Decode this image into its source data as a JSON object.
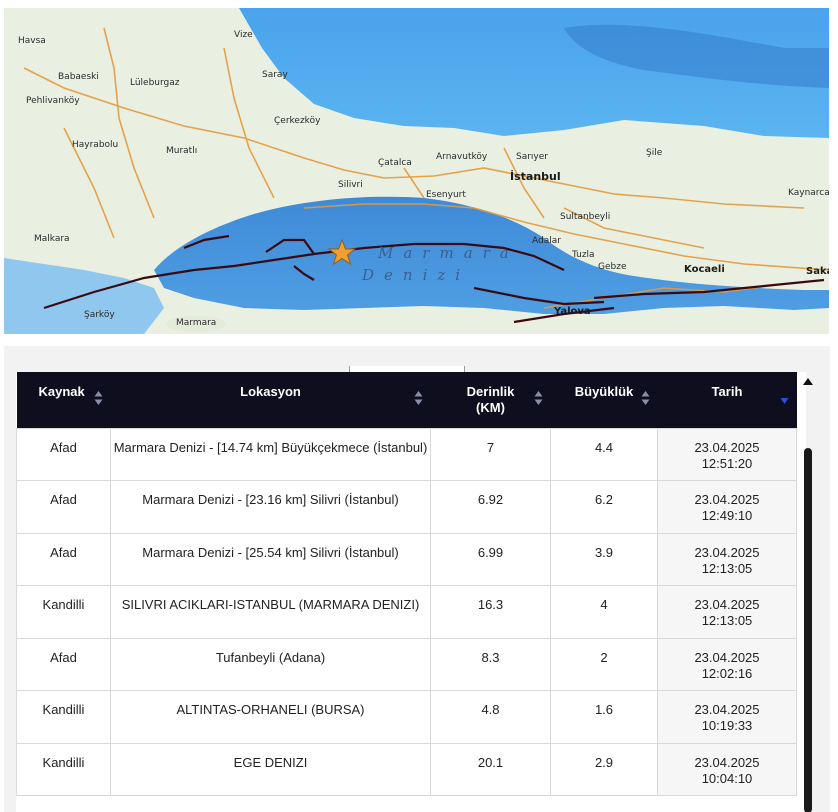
{
  "map": {
    "sea_name_line1": "Marmara",
    "sea_name_line2": "Denizi",
    "labels": {
      "havsa": "Havsa",
      "babaeski": "Babaeski",
      "pehlivankoy": "Pehlivanköy",
      "luleburgaz": "Lüleburgaz",
      "vize": "Vize",
      "saray": "Saray",
      "cerkezkoy": "Çerkezköy",
      "hayrabolu": "Hayrabolu",
      "muratli": "Muratlı",
      "catalca": "Çatalca",
      "arnavutkoy": "Arnavutköy",
      "sariyer": "Sarıyer",
      "sile": "Şile",
      "istanbul": "İstanbul",
      "silivri": "Silivri",
      "esenyurt": "Esenyurt",
      "sultanbeyli": "Sultanbeyli",
      "kaynarca": "Kaynarca",
      "malkara": "Malkara",
      "adalar": "Adalar",
      "tuzla": "Tuzla",
      "gebze": "Gebze",
      "kocaeli": "Kocaeli",
      "yalova": "Yalova",
      "sarkoy": "Şarköy",
      "marmara": "Marmara",
      "sak": "Saka"
    }
  },
  "table": {
    "headers": {
      "source": "Kaynak",
      "location": "Lokasyon",
      "depth_line1": "Derinlik",
      "depth_line2": "(KM)",
      "magnitude": "Büyüklük",
      "date": "Tarih"
    },
    "rows": [
      {
        "source": "Afad",
        "location": "Marmara Denizi - [14.74 km] Büyükçekmece (İstanbul)",
        "depth": "7",
        "magnitude": "4.4",
        "date": "23.04.2025",
        "time": "12:51:20"
      },
      {
        "source": "Afad",
        "location": "Marmara Denizi - [23.16 km] Silivri (İstanbul)",
        "depth": "6.92",
        "magnitude": "6.2",
        "date": "23.04.2025",
        "time": "12:49:10"
      },
      {
        "source": "Afad",
        "location": "Marmara Denizi - [25.54 km] Silivri (İstanbul)",
        "depth": "6.99",
        "magnitude": "3.9",
        "date": "23.04.2025",
        "time": "12:13:05"
      },
      {
        "source": "Kandilli",
        "location": "SILIVRI ACIKLARI-ISTANBUL (MARMARA DENIZI)",
        "depth": "16.3",
        "magnitude": "4",
        "date": "23.04.2025",
        "time": "12:13:05"
      },
      {
        "source": "Afad",
        "location": "Tufanbeyli (Adana)",
        "depth": "8.3",
        "magnitude": "2",
        "date": "23.04.2025",
        "time": "12:02:16"
      },
      {
        "source": "Kandilli",
        "location": "ALTINTAS-ORHANELI (BURSA)",
        "depth": "4.8",
        "magnitude": "1.6",
        "date": "23.04.2025",
        "time": "10:19:33"
      },
      {
        "source": "Kandilli",
        "location": "EGE DENIZI",
        "depth": "20.1",
        "magnitude": "2.9",
        "date": "23.04.2025",
        "time": "10:04:10"
      }
    ]
  },
  "colors": {
    "header_bg": "#0e0e1f",
    "sea": "#3a86d6",
    "land": "#e7efe0",
    "fault": "#3a0a14",
    "epicenter": "#f0a030"
  }
}
